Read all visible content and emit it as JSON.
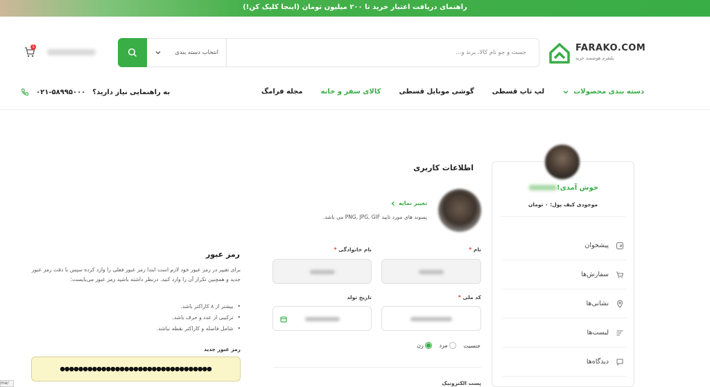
{
  "promo": {
    "text": "راهنمای دریافت اعتبار خرید تا ۲۰۰ میلیون تومان (اینجا کلیک کن!)"
  },
  "brand": {
    "name": "FARAKO.COM",
    "tagline": "پلتفرم هوشمند خرید"
  },
  "search": {
    "placeholder": "جست و جو نام کالا، برند و...",
    "category": "انتخاب دسته بندی"
  },
  "cart": {
    "count": "1"
  },
  "nav": {
    "items": [
      {
        "label": "دسته بندی محصولات",
        "highlight": true
      },
      {
        "label": "لپ تاپ قسطی",
        "highlight": false
      },
      {
        "label": "گوشی موبایل قسطی",
        "highlight": false
      },
      {
        "label": "کالای سفر و خانه",
        "highlight": true
      },
      {
        "label": "مجله فرامگ",
        "highlight": false
      }
    ],
    "help_text": "به راهنمایی نیاز دارید؟",
    "phone": "۰۲۱-۵۸۹۹۵۰۰۰"
  },
  "sidebar": {
    "welcome": "خوش آمدی!",
    "wallet": "موجودی کیف پول: ۰ تومان",
    "items": [
      {
        "label": "پیشخوان",
        "icon": "dashboard-icon"
      },
      {
        "label": "سفارش‌ها",
        "icon": "cart-icon"
      },
      {
        "label": "نشانی‌ها",
        "icon": "location-icon"
      },
      {
        "label": "لیست‌ها",
        "icon": "list-icon"
      },
      {
        "label": "دیدگاه‌ها",
        "icon": "comment-icon"
      }
    ]
  },
  "profile": {
    "title": "اطلاعات کاربری",
    "change_photo": "تغییر نمایه",
    "formats": "پسوند های مورد تایید PNG, JPG, GIF می باشد.",
    "first_name_label": "نام",
    "last_name_label": "نام خانوادگی",
    "national_id_label": "کد ملی",
    "birth_date_label": "تاریخ تولد",
    "gender_label": "جنسیت",
    "gender_male": "مرد",
    "gender_female": "زن",
    "email_label": "پست الکترونیک"
  },
  "password": {
    "title": "رمز عبور",
    "description": "برای تغییر در رمز عبور خود لازم است ابتدا رمز عبور فعلی را وارد کرده سپس با دقت رمز عبور جدید و همچنین تکرار آن را وارد کنید. درنظر داشته باشید رمز عبور می‌بایست:",
    "rules": [
      "بیشتر از ۸ کاراکتر باشد.",
      "ترکیبی از عدد و حرف باشد.",
      "شامل فاصله و کاراکتر نقطه نباشد."
    ],
    "new_label": "رمز عبور جدید",
    "new_value": "●●●●●●●●●●●●●●●●●●●●●●●●●●●●●●●●●"
  },
  "corner_tip": "me/",
  "colors": {
    "brand_green": "#39ad46",
    "required": "#e53935",
    "autofill": "#fbf6c9"
  }
}
